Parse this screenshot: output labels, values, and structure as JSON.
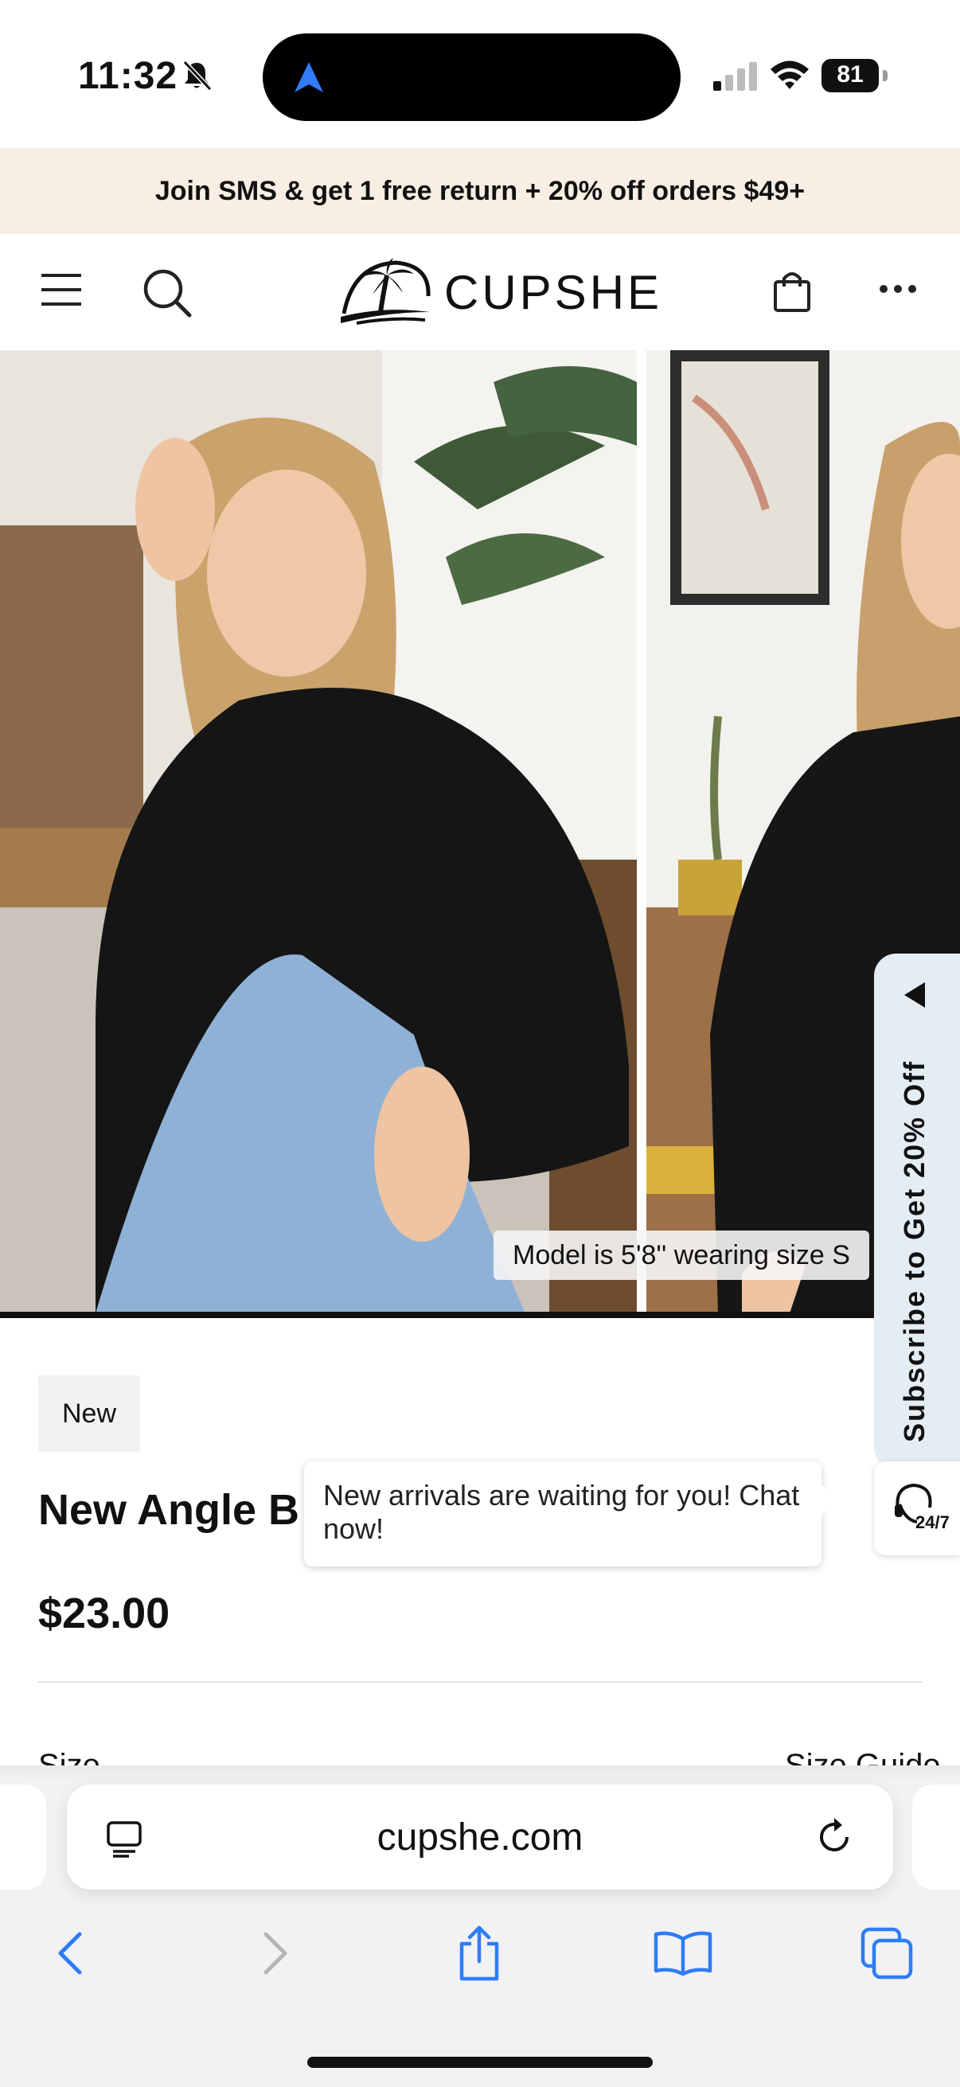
{
  "status_bar": {
    "time": "11:32",
    "battery": "81"
  },
  "promo": {
    "text": "Join SMS & get 1 free return + 20% off orders $49+"
  },
  "header": {
    "brand": "CUPSHE"
  },
  "gallery": {
    "model_note": "Model is 5'8'' wearing size S"
  },
  "subscribe_tab": {
    "label": "Subscribe to Get 20% Off"
  },
  "product": {
    "badge": "New",
    "title": "New Angle Bl",
    "price": "$23.00",
    "size_label": "Size",
    "size_guide": "Size Guide"
  },
  "chat": {
    "bubble_text": "New arrivals are waiting for you! Chat now!",
    "badge": "24/7"
  },
  "browser": {
    "url": "cupshe.com"
  },
  "icons": {
    "bell": "bell-slash-icon",
    "location": "location-arrow-icon",
    "menu": "hamburger-menu-icon",
    "search": "search-icon",
    "bag": "shopping-bag-icon",
    "more": "more-dots-icon",
    "chat": "headset-chat-icon",
    "reader": "reader-mode-icon",
    "reload": "reload-icon",
    "back": "back-chevron-icon",
    "forward": "forward-chevron-icon",
    "share": "share-icon",
    "bookmarks": "bookmarks-book-icon",
    "tabs": "tabs-icon"
  },
  "colors": {
    "promo_bg": "#f8eee3",
    "subscribe_bg": "#e4edf3",
    "ios_blue": "#2f7cf6"
  }
}
